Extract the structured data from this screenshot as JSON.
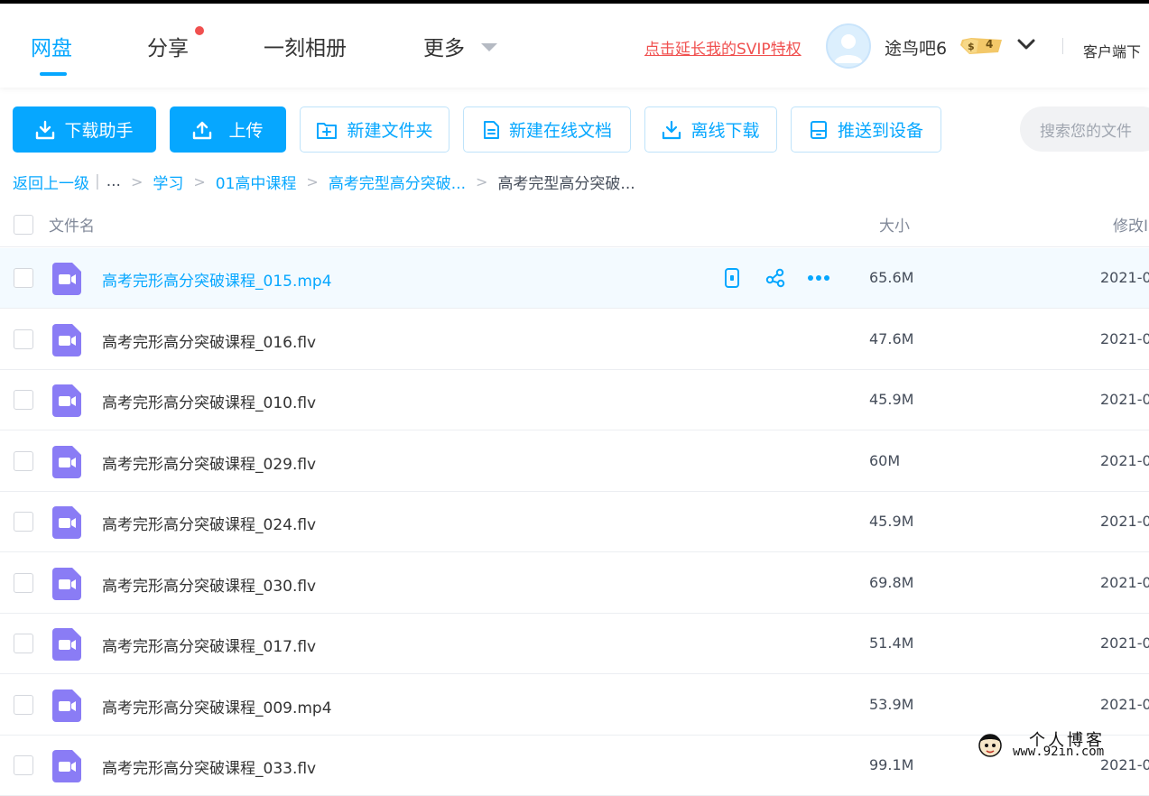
{
  "nav": {
    "tabs": [
      {
        "label": "网盘"
      },
      {
        "label": "分享"
      },
      {
        "label": "一刻相册"
      },
      {
        "label": "更多"
      }
    ]
  },
  "header": {
    "svip_link": "点击延长我的SVIP特权",
    "username": "途鸟吧6",
    "vip_level": "4",
    "client_download": "客户端下"
  },
  "toolbar": {
    "download_helper": "下载助手",
    "upload": "上传",
    "new_folder": "新建文件夹",
    "new_online_doc": "新建在线文档",
    "offline_download": "离线下载",
    "push_to_device": "推送到设备",
    "search_placeholder": "搜索您的文件"
  },
  "breadcrumb": {
    "back": "返回上一级",
    "pipe": "|",
    "ellipsis": "...",
    "items": [
      "学习",
      "01高中课程",
      "高考完型高分突破..."
    ],
    "current": "高考完型高分突破..."
  },
  "table": {
    "headers": {
      "name": "文件名",
      "size": "大小",
      "modified": "修改I"
    },
    "rows": [
      {
        "name": "高考完形高分突破课程_015.mp4",
        "size": "65.6M",
        "date": "2021-0"
      },
      {
        "name": "高考完形高分突破课程_016.flv",
        "size": "47.6M",
        "date": "2021-0"
      },
      {
        "name": "高考完形高分突破课程_010.flv",
        "size": "45.9M",
        "date": "2021-0"
      },
      {
        "name": "高考完形高分突破课程_029.flv",
        "size": "60M",
        "date": "2021-0"
      },
      {
        "name": "高考完形高分突破课程_024.flv",
        "size": "45.9M",
        "date": "2021-0"
      },
      {
        "name": "高考完形高分突破课程_030.flv",
        "size": "69.8M",
        "date": "2021-0"
      },
      {
        "name": "高考完形高分突破课程_017.flv",
        "size": "51.4M",
        "date": "2021-0"
      },
      {
        "name": "高考完形高分突破课程_009.mp4",
        "size": "53.9M",
        "date": "2021-0"
      },
      {
        "name": "高考完形高分突破课程_033.flv",
        "size": "99.1M",
        "date": "2021-0"
      }
    ]
  },
  "watermark": {
    "title": "个人博客",
    "url": "www.92in.com"
  },
  "colors": {
    "accent": "#06a7ff",
    "svip_red": "#f0504f",
    "video_icon": "#8a7cf5",
    "hover_row": "#f3faff"
  },
  "icons": {
    "row_actions": [
      "phone-push-icon",
      "share-icon",
      "more-icon"
    ],
    "file_type": "video-file-icon"
  }
}
